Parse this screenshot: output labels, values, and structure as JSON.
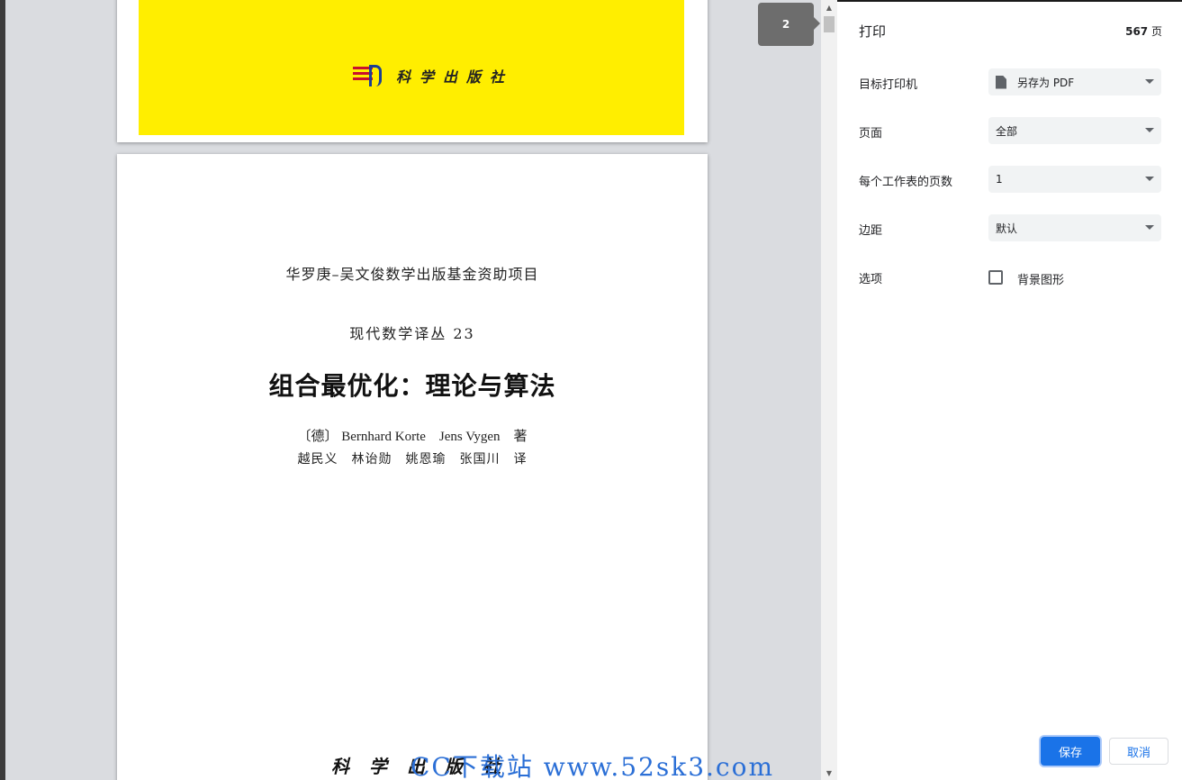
{
  "preview": {
    "page_tip": "2",
    "cover_publisher": "科学出版社",
    "title_page": {
      "fund": "华罗庚–吴文俊数学出版基金资助项目",
      "series": "现代数学译丛 23",
      "title": "组合最优化：理论与算法",
      "authors": "〔德〕 Bernhard Korte　Jens Vygen　著",
      "translators": "越民义　林诒勋　姚恩瑜　张国川　译",
      "publisher": "科学出版社"
    }
  },
  "panel": {
    "title": "打印",
    "page_count_number": "567",
    "page_count_unit": "页",
    "destination": {
      "label": "目标打印机",
      "value": "另存为 PDF"
    },
    "pages": {
      "label": "页面",
      "value": "全部"
    },
    "pages_per_sheet": {
      "label": "每个工作表的页数",
      "value": "1"
    },
    "margins": {
      "label": "边距",
      "value": "默认"
    },
    "options": {
      "label": "选项",
      "background_graphics": "背景图形"
    },
    "save_label": "保存",
    "cancel_label": "取消"
  },
  "watermark": "CC下载站 www.52sk3.com"
}
